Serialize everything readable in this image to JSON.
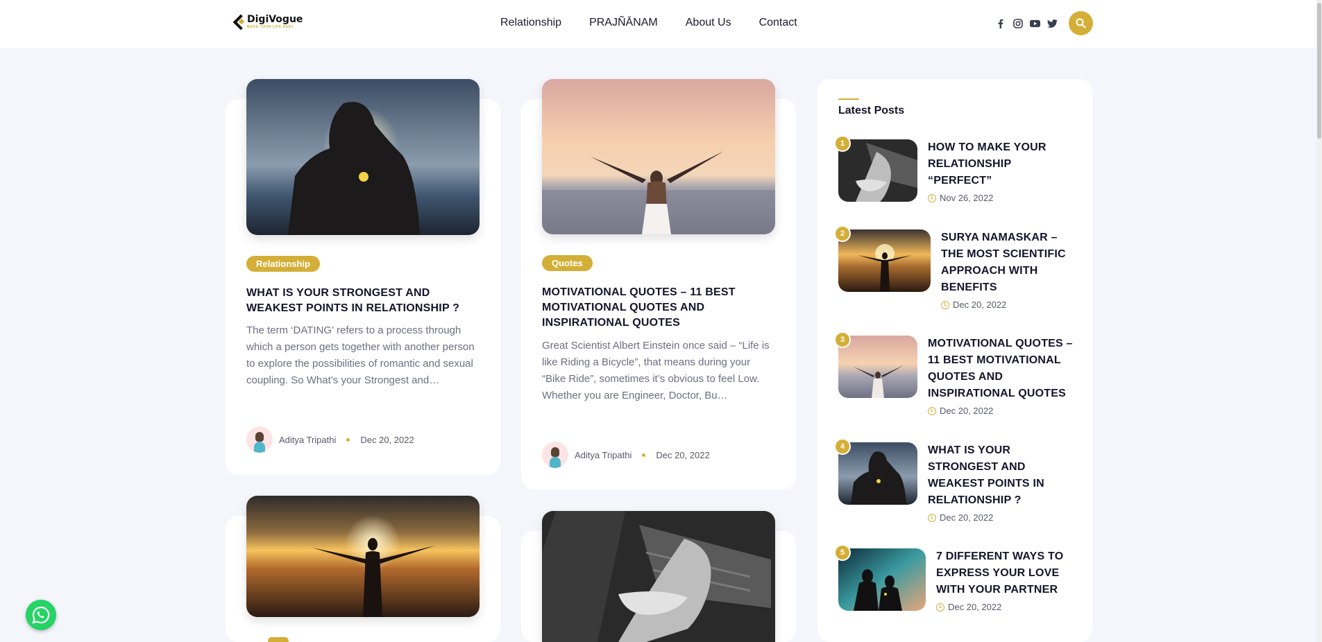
{
  "header": {
    "logo_name": "DigiVogue",
    "logo_tagline": "MAKE YOUR LIFE EASY",
    "nav": [
      "Relationship",
      "PRAJÑĀNAM",
      "About Us",
      "Contact"
    ],
    "socials": [
      "facebook-icon",
      "instagram-icon",
      "youtube-icon",
      "twitter-icon"
    ]
  },
  "posts": [
    {
      "category": "Relationship",
      "title": "WHAT IS YOUR STRONGEST AND WEAKEST POINTS IN RELATIONSHIP ?",
      "excerpt": "The term ‘DATING’ refers to a process through which a person gets together with another person to explore the possibilities of romantic and sexual coupling. So What’s your Strongest and…",
      "author": "Aditya Tripathi",
      "date": "Dec 20, 2022"
    },
    {
      "category": "Quotes",
      "title": "MOTIVATIONAL QUOTES – 11 BEST MOTIVATIONAL QUOTES AND INSPIRATIONAL QUOTES",
      "excerpt": "Great Scientist Albert Einstein once said – “Life is like Riding a Bicycle”, that means during your “Bike Ride”, sometimes it’s obvious to feel Low. Whether you are Engineer, Doctor, Bu…",
      "author": "Aditya Tripathi",
      "date": "Dec 20, 2022"
    }
  ],
  "sidebar": {
    "title": "Latest Posts",
    "items": [
      {
        "num": "1",
        "title": "HOW TO MAKE YOUR RELATIONSHIP “PERFECT”",
        "date": "Nov 26, 2022"
      },
      {
        "num": "2",
        "title": "SURYA NAMASKAR – THE MOST SCIENTIFIC APPROACH WITH BENEFITS",
        "date": "Dec 20, 2022"
      },
      {
        "num": "3",
        "title": "MOTIVATIONAL QUOTES – 11 BEST MOTIVATIONAL QUOTES AND INSPIRATIONAL QUOTES",
        "date": "Dec 20, 2022"
      },
      {
        "num": "4",
        "title": "WHAT IS YOUR STRONGEST AND WEAKEST POINTS IN RELATIONSHIP ?",
        "date": "Dec 20, 2022"
      },
      {
        "num": "5",
        "title": "7 DIFFERENT WAYS TO EXPRESS YOUR LOVE WITH YOUR PARTNER",
        "date": "Dec 20, 2022"
      }
    ]
  },
  "colors": {
    "accent": "#d4af37",
    "background": "#f5f6fb",
    "whatsapp": "#25d366"
  }
}
